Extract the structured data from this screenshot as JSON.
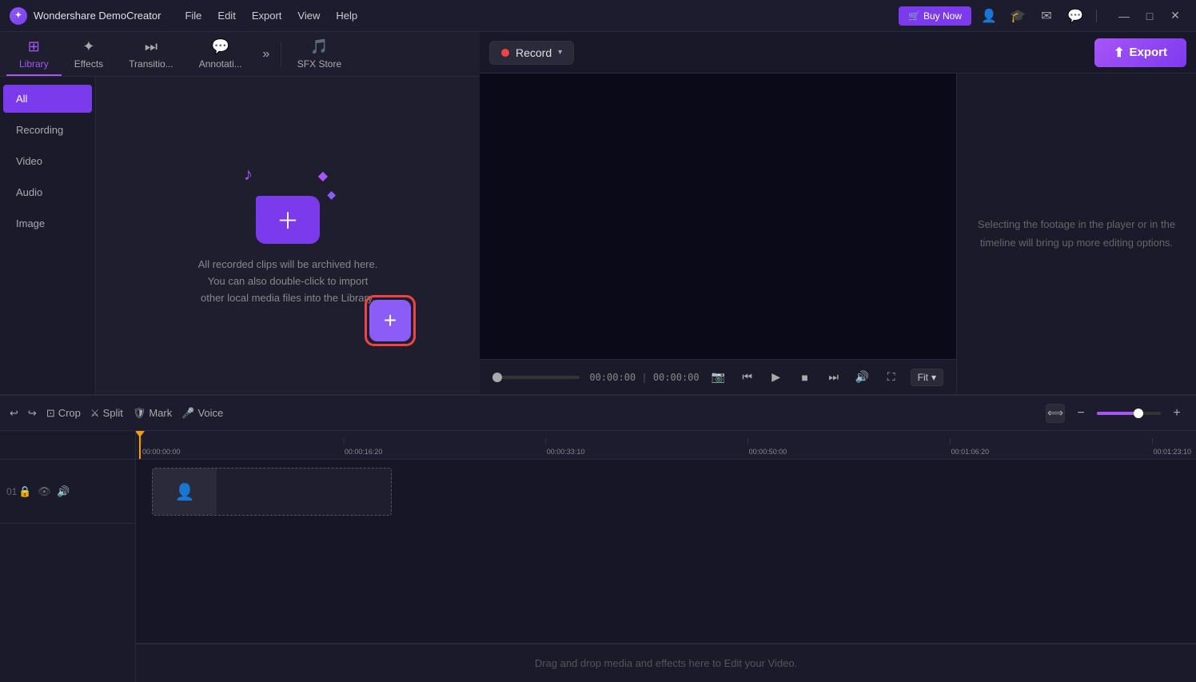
{
  "app": {
    "name": "Wondershare DemoCreator",
    "logo": "W"
  },
  "titlebar": {
    "menu": [
      "File",
      "Edit",
      "Export",
      "View",
      "Help"
    ],
    "buy_now": "Buy Now",
    "window_controls": [
      "—",
      "□",
      "✕"
    ]
  },
  "tabs": {
    "items": [
      {
        "id": "library",
        "label": "Library",
        "active": true
      },
      {
        "id": "effects",
        "label": "Effects"
      },
      {
        "id": "transitions",
        "label": "Transitio..."
      },
      {
        "id": "annotations",
        "label": "Annotati..."
      }
    ],
    "sfx_label": "SFX Store"
  },
  "sidebar": {
    "items": [
      {
        "id": "all",
        "label": "All",
        "active": true
      },
      {
        "id": "recording",
        "label": "Recording"
      },
      {
        "id": "video",
        "label": "Video"
      },
      {
        "id": "audio",
        "label": "Audio"
      },
      {
        "id": "image",
        "label": "Image"
      }
    ]
  },
  "library": {
    "empty_text": "All recorded clips will be archived here.\nYou can also double-click to import\nother local media files into the Library.",
    "add_btn": "+"
  },
  "toolbar": {
    "record_label": "Record",
    "export_label": "Export"
  },
  "preview": {
    "timecode_current": "00:00:00",
    "timecode_total": "00:00:00",
    "fit_label": "Fit",
    "properties_text": "Selecting the footage in the player or in the timeline will bring up more editing options."
  },
  "timeline_toolbar": {
    "undo_label": "",
    "redo_label": "",
    "crop_label": "Crop",
    "split_label": "Split",
    "mark_label": "Mark",
    "voice_label": "Voice",
    "zoom_in_label": "+",
    "zoom_out_label": "−"
  },
  "timeline": {
    "ruler_marks": [
      "00:00:00:00",
      "00:00:16:20",
      "00:00:33:10",
      "00:00:50:00",
      "00:01:06:20",
      "00:01:23:10"
    ],
    "drag_drop_text": "Drag and drop media and effects here to Edit your Video.",
    "track_number": "01"
  }
}
